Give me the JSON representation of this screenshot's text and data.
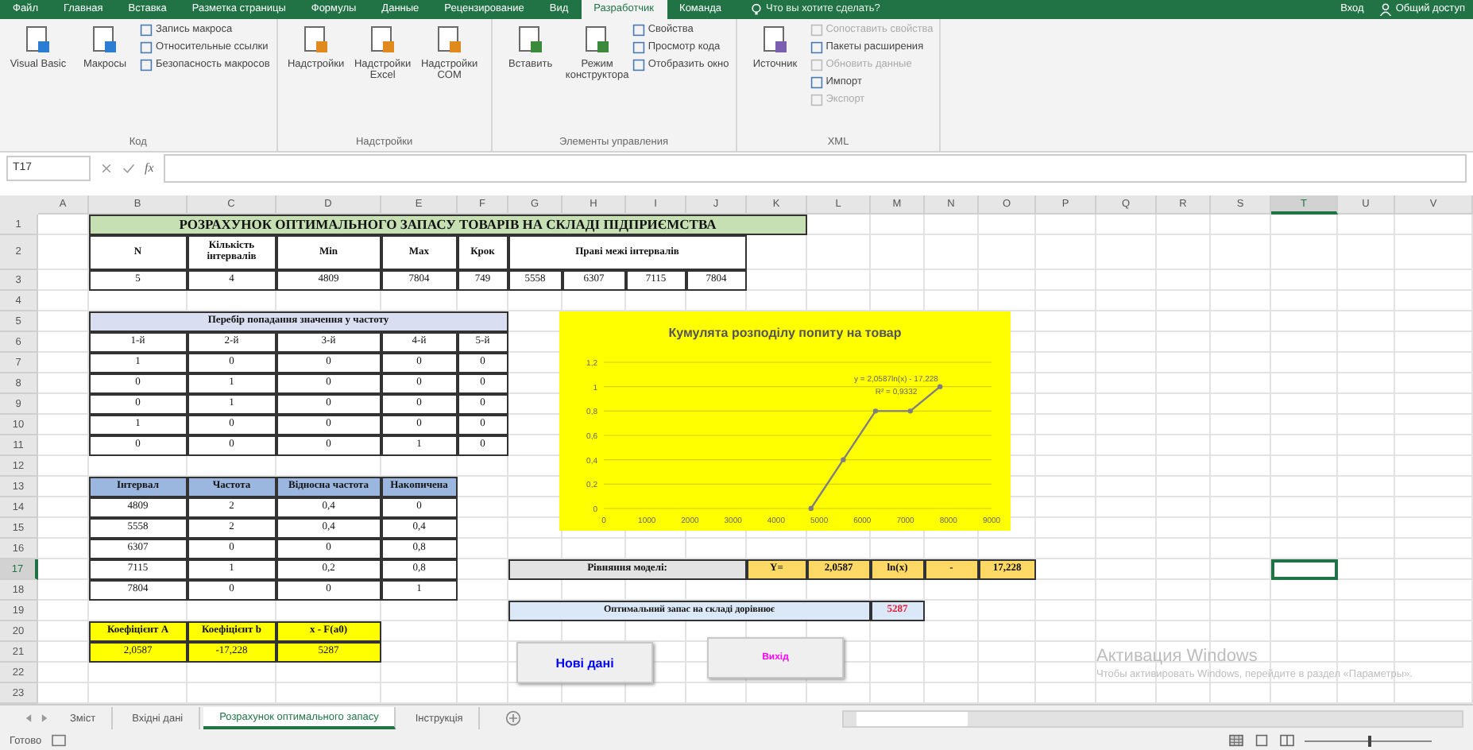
{
  "ribbon": {
    "tabs": [
      {
        "label": "Файл",
        "selected": false
      },
      {
        "label": "Главная",
        "selected": false
      },
      {
        "label": "Вставка",
        "selected": false
      },
      {
        "label": "Разметка страницы",
        "selected": false
      },
      {
        "label": "Формулы",
        "selected": false
      },
      {
        "label": "Данные",
        "selected": false
      },
      {
        "label": "Рецензирование",
        "selected": false
      },
      {
        "label": "Вид",
        "selected": false
      },
      {
        "label": "Разработчик",
        "selected": true
      },
      {
        "label": "Команда",
        "selected": false
      }
    ],
    "search": {
      "placeholder": "Что вы хотите сделать?"
    },
    "sign_in": "Вход",
    "share": "Общий доступ",
    "groups": [
      {
        "label": "Код",
        "items": [
          {
            "kind": "large",
            "label": "Visual Basic",
            "disabled": false
          },
          {
            "kind": "large",
            "label": "Макросы",
            "disabled": false
          },
          {
            "kind": "small",
            "label": "Запись макроса",
            "disabled": false
          },
          {
            "kind": "small",
            "label": "Относительные ссылки",
            "disabled": false
          },
          {
            "kind": "small",
            "label": "Безопасность макросов",
            "disabled": false
          }
        ]
      },
      {
        "label": "Надстройки",
        "items": [
          {
            "kind": "large",
            "label": "Надстройки",
            "disabled": false
          },
          {
            "kind": "large",
            "label": "Надстройки Excel",
            "disabled": false
          },
          {
            "kind": "large",
            "label": "Надстройки COM",
            "disabled": false
          }
        ]
      },
      {
        "label": "Элементы управления",
        "items": [
          {
            "kind": "large",
            "label": "Вставить",
            "disabled": false
          },
          {
            "kind": "large",
            "label": "Режим конструктора",
            "disabled": false
          },
          {
            "kind": "small",
            "label": "Свойства",
            "disabled": false
          },
          {
            "kind": "small",
            "label": "Просмотр кода",
            "disabled": false
          },
          {
            "kind": "small",
            "label": "Отобразить окно",
            "disabled": false
          }
        ]
      },
      {
        "label": "XML",
        "items": [
          {
            "kind": "large",
            "label": "Источник",
            "disabled": false
          },
          {
            "kind": "small",
            "label": "Сопоставить свойства",
            "disabled": true
          },
          {
            "kind": "small",
            "label": "Пакеты расширения",
            "disabled": false
          },
          {
            "kind": "small",
            "label": "Обновить данные",
            "disabled": true
          },
          {
            "kind": "small",
            "label": "Импорт",
            "disabled": false
          },
          {
            "kind": "small",
            "label": "Экспорт",
            "disabled": true
          }
        ]
      }
    ]
  },
  "formula_bar": {
    "name_box": "T17",
    "fx": "fx"
  },
  "sheet": {
    "columns": [
      {
        "label": "A",
        "selected": false
      },
      {
        "label": "B",
        "selected": false
      },
      {
        "label": "C",
        "selected": false
      },
      {
        "label": "D",
        "selected": false
      },
      {
        "label": "E",
        "selected": false
      },
      {
        "label": "F",
        "selected": false
      },
      {
        "label": "G",
        "selected": false
      },
      {
        "label": "H",
        "selected": false
      },
      {
        "label": "I",
        "selected": false
      },
      {
        "label": "J",
        "selected": false
      },
      {
        "label": "K",
        "selected": false
      },
      {
        "label": "L",
        "selected": false
      },
      {
        "label": "M",
        "selected": false
      },
      {
        "label": "N",
        "selected": false
      },
      {
        "label": "O",
        "selected": false
      },
      {
        "label": "P",
        "selected": false
      },
      {
        "label": "Q",
        "selected": false
      },
      {
        "label": "R",
        "selected": false
      },
      {
        "label": "S",
        "selected": false
      },
      {
        "label": "T",
        "selected": true
      },
      {
        "label": "U",
        "selected": false
      },
      {
        "label": "V",
        "selected": false
      }
    ],
    "rows": [
      {
        "label": "1",
        "selected": false
      },
      {
        "label": "2",
        "selected": false
      },
      {
        "label": "3",
        "selected": false
      },
      {
        "label": "4",
        "selected": false
      },
      {
        "label": "5",
        "selected": false
      },
      {
        "label": "6",
        "selected": false
      },
      {
        "label": "7",
        "selected": false
      },
      {
        "label": "8",
        "selected": false
      },
      {
        "label": "9",
        "selected": false
      },
      {
        "label": "10",
        "selected": false
      },
      {
        "label": "11",
        "selected": false
      },
      {
        "label": "12",
        "selected": false
      },
      {
        "label": "13",
        "selected": false
      },
      {
        "label": "14",
        "selected": false
      },
      {
        "label": "15",
        "selected": false
      },
      {
        "label": "16",
        "selected": false
      },
      {
        "label": "17",
        "selected": true
      },
      {
        "label": "18",
        "selected": false
      },
      {
        "label": "19",
        "selected": false
      },
      {
        "label": "20",
        "selected": false
      },
      {
        "label": "21",
        "selected": false
      },
      {
        "label": "22",
        "selected": false
      },
      {
        "label": "23",
        "selected": false
      }
    ]
  },
  "title": "РОЗРАХУНОК ОПТИМАЛЬНОГО ЗАПАСУ ТОВАРІВ НА СКЛАДІ ПІДПРИЄМСТВА",
  "params_table": {
    "headers": [
      "N",
      "Кількість інтервалів",
      "Min",
      "Max",
      "Крок",
      "Праві межі інтервалів"
    ],
    "values": [
      "5",
      "4",
      "4809",
      "7804",
      "749",
      "5558",
      "6307",
      "7115",
      "7804"
    ]
  },
  "hits_table": {
    "title": "Перебір попадання значення у частоту",
    "headers": [
      "1-й",
      "2-й",
      "3-й",
      "4-й",
      "5-й"
    ],
    "rows": [
      [
        "1",
        "0",
        "0",
        "0",
        "0"
      ],
      [
        "0",
        "1",
        "0",
        "0",
        "0"
      ],
      [
        "0",
        "1",
        "0",
        "0",
        "0"
      ],
      [
        "1",
        "0",
        "0",
        "0",
        "0"
      ],
      [
        "0",
        "0",
        "0",
        "1",
        "0"
      ]
    ]
  },
  "freq_table": {
    "headers": [
      "Інтервал",
      "Частота",
      "Відносна частота",
      "Накопичена"
    ],
    "rows": [
      [
        "4809",
        "2",
        "0,4",
        "0"
      ],
      [
        "5558",
        "2",
        "0,4",
        "0,4"
      ],
      [
        "6307",
        "0",
        "0",
        "0,8"
      ],
      [
        "7115",
        "1",
        "0,2",
        "0,8"
      ],
      [
        "7804",
        "0",
        "0",
        "1"
      ]
    ]
  },
  "coef_table": {
    "headers": [
      "Коефіцієнт A",
      "Коефіцієнт b",
      "x - F(a0)"
    ],
    "values": [
      "2,0587",
      "-17,228",
      "5287"
    ]
  },
  "chart": {
    "chart_data": {
      "type": "line",
      "title": "Кумулята розподілу попиту на товар",
      "x": [
        4809,
        5558,
        6307,
        7115,
        7804
      ],
      "grid": true,
      "series": [
        {
          "color": "#7f7f7f",
          "marker": true,
          "values": [
            0,
            0.4,
            0.8,
            0.8,
            1
          ]
        }
      ],
      "xlim": [
        0,
        9000
      ],
      "ylim": [
        0,
        1.2
      ],
      "xticks": [
        0,
        1000,
        2000,
        3000,
        4000,
        5000,
        6000,
        7000,
        8000,
        9000
      ],
      "yticks": [
        0,
        {
          "value": 0.2,
          "label": "0,2"
        },
        {
          "value": 0.4,
          "label": "0,4"
        },
        {
          "value": 0.6,
          "label": "0,6"
        },
        {
          "value": 0.8,
          "label": "0,8"
        },
        1,
        {
          "value": 1.2,
          "label": "1,2"
        }
      ],
      "annotations": [
        "y = 2,0587ln(x) - 17,228",
        "R² = 0,9332"
      ]
    }
  },
  "model": {
    "label": "Рівняння моделі:",
    "parts": [
      "Y=",
      "2,0587",
      "ln(x)",
      "-",
      "17,228"
    ]
  },
  "optimum": {
    "label": "Оптимальний запас на складі дорівнює",
    "value": "5287"
  },
  "buttons": [
    {
      "label": "Нові дані",
      "color": "#0000ff"
    },
    {
      "label": "Вихід",
      "color": "#ff00ff"
    }
  ],
  "activation": {
    "title": "Активация Windows",
    "text": "Чтобы активировать Windows, перейдите в раздел «Параметры»."
  },
  "sheet_tabs": [
    {
      "label": "Зміст",
      "selected": false
    },
    {
      "label": "Вхідні дані",
      "selected": false
    },
    {
      "label": "Розрахунок оптимального запасу",
      "selected": true
    },
    {
      "label": "Інструкція",
      "selected": false
    }
  ],
  "status_bar": {
    "text": "Готово",
    "zoom": {
      "level": 0.5
    }
  }
}
